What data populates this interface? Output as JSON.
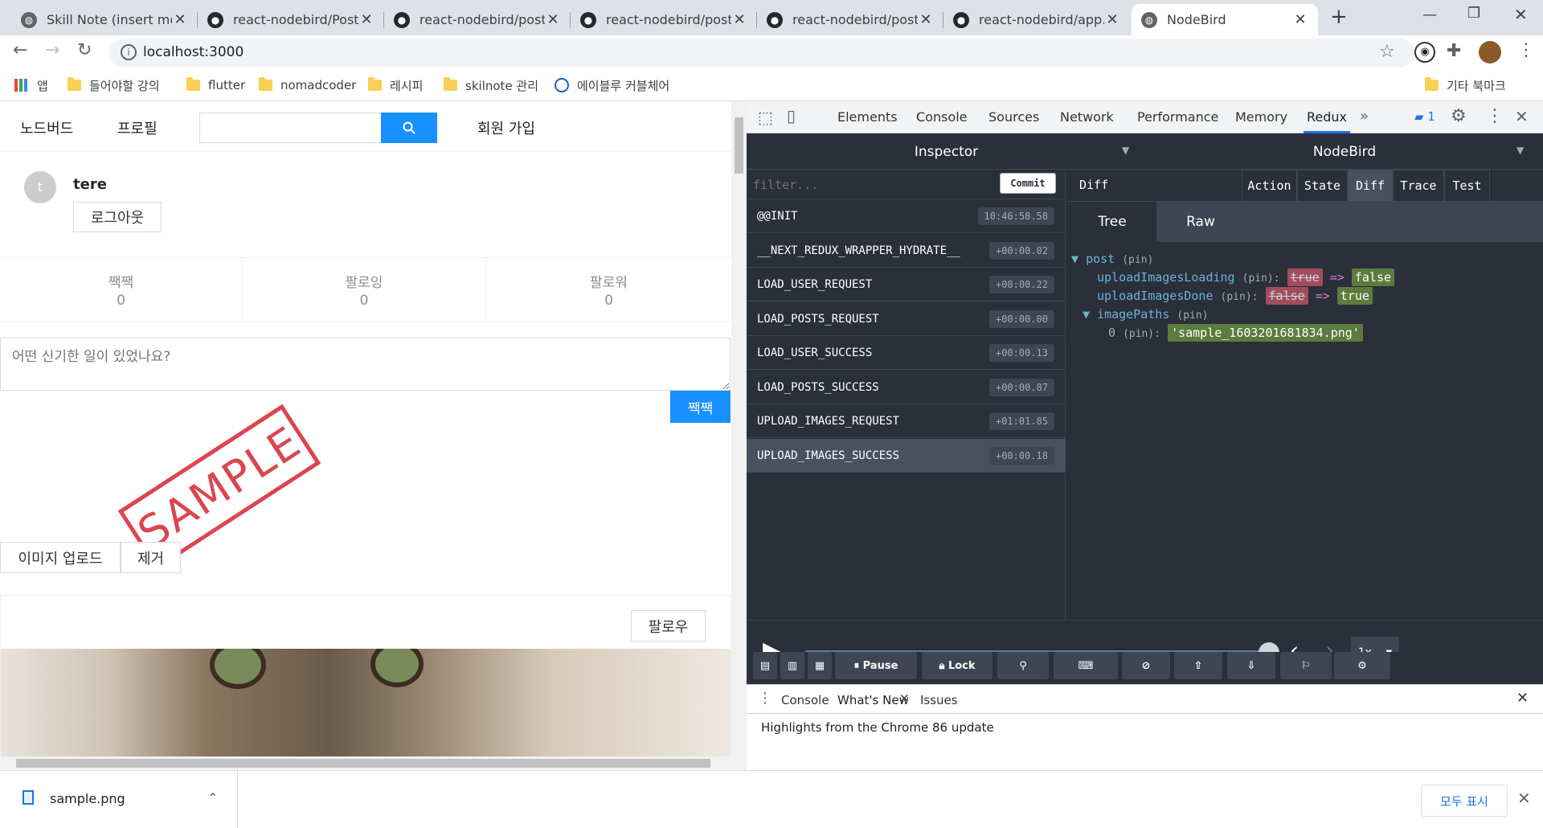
{
  "tabs": [
    {
      "title": "Skill Note (insert mod",
      "icon": "globe-icon"
    },
    {
      "title": "react-nodebird/PostFo",
      "icon": "github-icon"
    },
    {
      "title": "react-nodebird/post.js",
      "icon": "github-icon"
    },
    {
      "title": "react-nodebird/post.js",
      "icon": "github-icon"
    },
    {
      "title": "react-nodebird/post.js",
      "icon": "github-icon"
    },
    {
      "title": "react-nodebird/app.js",
      "icon": "github-icon"
    },
    {
      "title": "NodeBird",
      "icon": "globe-icon"
    }
  ],
  "toolbar": {
    "url": "localhost:3000"
  },
  "bookmarks": {
    "apps": "앱",
    "items": [
      "들어야할 강의",
      "flutter",
      "nomadcoder",
      "레시피",
      "skilnote 관리",
      "에이블루 커블체어"
    ],
    "other": "기타 북마크"
  },
  "page": {
    "nav": {
      "home": "노드버드",
      "profile": "프로필",
      "signup": "회원 가입",
      "search_placeholder": ""
    },
    "user": {
      "avatar_letter": "t",
      "name": "tere",
      "logout": "로그아웃"
    },
    "stats": [
      {
        "label": "짹짹",
        "value": "0"
      },
      {
        "label": "팔로잉",
        "value": "0"
      },
      {
        "label": "팔로워",
        "value": "0"
      }
    ],
    "post_form": {
      "placeholder": "어떤 신기한 일이 있었나요?",
      "submit": "짹짹",
      "upload": "이미지 업로드",
      "remove": "제거"
    },
    "stamp": "SAMPLE",
    "post": {
      "follow": "팔로우"
    }
  },
  "devtools": {
    "tabs": [
      "Elements",
      "Console",
      "Sources",
      "Network",
      "Performance",
      "Memory",
      "Redux"
    ],
    "issues_count": "1",
    "redux": {
      "inspector": "Inspector",
      "store": "NodeBird",
      "filter_placeholder": "filter...",
      "commit": "Commit",
      "actions": [
        {
          "name": "@@INIT",
          "time": "10:46:58.58"
        },
        {
          "name": "__NEXT_REDUX_WRAPPER_HYDRATE__",
          "time": "+00:00.02"
        },
        {
          "name": "LOAD_USER_REQUEST",
          "time": "+00:00.22"
        },
        {
          "name": "LOAD_POSTS_REQUEST",
          "time": "+00:00.00"
        },
        {
          "name": "LOAD_USER_SUCCESS",
          "time": "+00:00.13"
        },
        {
          "name": "LOAD_POSTS_SUCCESS",
          "time": "+00:00.87"
        },
        {
          "name": "UPLOAD_IMAGES_REQUEST",
          "time": "+01:01.85"
        },
        {
          "name": "UPLOAD_IMAGES_SUCCESS",
          "time": "+00:00.18"
        }
      ],
      "monitor_title": "Diff",
      "monitor_tabs": [
        "Action",
        "State",
        "Diff",
        "Trace",
        "Test"
      ],
      "view_tabs": [
        "Tree",
        "Raw"
      ],
      "tree": {
        "root_key": "post",
        "pin": "(pin)",
        "arrow": "=>",
        "k1": "uploadImagesLoading",
        "k1_old": "true",
        "k1_new": "false",
        "k2": "uploadImagesDone",
        "k2_old": "false",
        "k2_new": "true",
        "k3": "imagePaths",
        "k3_index": "0",
        "k3_value": "'sample_1603201681834.png'"
      },
      "speed": "1x",
      "buttons": {
        "pause": "Pause",
        "lock": "Lock"
      }
    },
    "drawer": {
      "tabs": [
        "Console",
        "What's New",
        "Issues"
      ],
      "headline": "Highlights from the Chrome 86 update"
    }
  },
  "download": {
    "file": "sample.png",
    "show_all": "모두 표시"
  },
  "colors": {
    "primary": "#1890ff",
    "redux_bg": "#2a2f3a",
    "stamp": "#d9313d"
  }
}
